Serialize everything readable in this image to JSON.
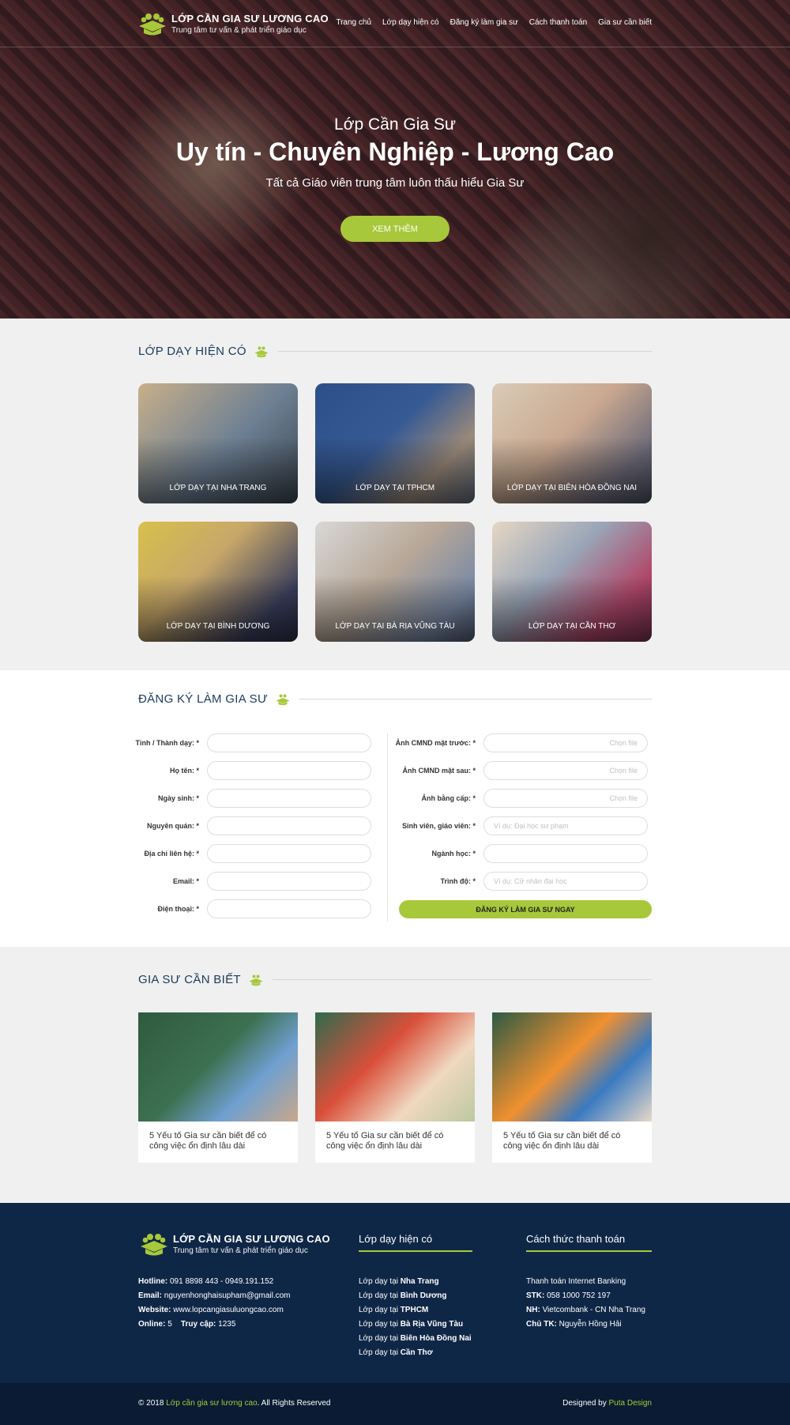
{
  "brand": {
    "name": "LỚP CẦN GIA SƯ LƯƠNG CAO",
    "tagline": "Trung tâm tư vấn & phát triển giáo dục",
    "accent_color": "#a7c83a",
    "navy_color": "#0f2747"
  },
  "nav": {
    "items": [
      "Trang chủ",
      "Lớp dạy hiện có",
      "Đăng ký làm gia sư",
      "Cách thanh toán",
      "Gia sư cần biết"
    ]
  },
  "hero": {
    "kicker": "Lớp Cần Gia Sư",
    "title": "Uy tín - Chuyên Nghiệp - Lương Cao",
    "subtitle": "Tất cả Giáo viên trung tâm luôn thấu hiểu Gia Sư",
    "button": "XEM THÊM"
  },
  "classes": {
    "title": "LỚP DẠY HIỆN CÓ",
    "items": [
      "LỚP DẠY TẠI NHA TRANG",
      "LỚP DẠY TẠI TPHCM",
      "LỚP DẠY TẠI BIÊN HÒA ĐỒNG NAI",
      "LỚP DẠY TẠI BÌNH DƯƠNG",
      "LỚP DẠY TẠI BÀ RỊA VŨNG TÀU",
      "LỚP DẠY TẠI CẦN THƠ"
    ]
  },
  "register": {
    "title": "ĐĂNG KÝ LÀM GIA SƯ",
    "left_fields": [
      "Tỉnh / Thành dạy: *",
      "Họ tên: *",
      "Ngày sinh: *",
      "Nguyên quán: *",
      "Địa chỉ liên hệ: *",
      "Email: *",
      "Điện thoại: *"
    ],
    "right_fields": [
      {
        "label": "Ảnh CMND mặt trước: *",
        "placeholder": "Chọn file"
      },
      {
        "label": "Ảnh CMND mặt sau: *",
        "placeholder": "Chọn file"
      },
      {
        "label": "Ảnh bằng cấp: *",
        "placeholder": "Chọn file"
      },
      {
        "label": "Sinh viên, giáo viên: *",
        "placeholder": "Ví dụ: Đại học sư phạm"
      },
      {
        "label": "Ngành học: *",
        "placeholder": ""
      },
      {
        "label": "Trình độ: *",
        "placeholder": "Ví dụ: Cử nhân đại học"
      }
    ],
    "submit": "ĐĂNG KÝ LÀM GIA SƯ NGAY"
  },
  "articles": {
    "title": "GIA SƯ CẦN BIẾT",
    "items": [
      "5 Yếu tố Gia sư cần biết để có công việc ổn định lâu dài",
      "5 Yếu tố Gia sư cần biết để có công việc ổn định lâu dài",
      "5 Yếu tố Gia sư cần biết để có công việc ổn định lâu dài"
    ]
  },
  "footer": {
    "hotline_label": "Hotline:",
    "hotline": "091 8898 443 - 0949.191.152",
    "email_label": "Email:",
    "email": "nguyenhonghaisupham@gmail.com",
    "website_label": "Website:",
    "website": "www.lopcangiasuluongcao.com",
    "online_label": "Online:",
    "online": "5",
    "visits_label": "Truy cập:",
    "visits": "1235",
    "col2_title": "Lớp dạy hiện có",
    "col2_prefix": "Lớp dạy tại",
    "col2_items": [
      "Nha Trang",
      "Bình Dương",
      "TPHCM",
      "Bà Rịa Vũng Tàu",
      "Biên Hòa Đồng Nai",
      "Cần Thơ"
    ],
    "col3_title": "Cách thức thanh toán",
    "col3_line1": "Thanh toán Internet Banking",
    "stk_label": "STK:",
    "stk": "058 1000 752 197",
    "nh_label": "NH:",
    "nh": "Vietcombank - CN Nha Trang",
    "owner_label": "Chủ TK:",
    "owner": "Nguyễn Hồng Hải"
  },
  "copyright": {
    "prefix": "© 2018",
    "brand": "Lớp cần gia sư lương cao",
    "suffix": ". All Rights Reserved",
    "designed_by": "Designed by",
    "designer": "Puta Design"
  }
}
